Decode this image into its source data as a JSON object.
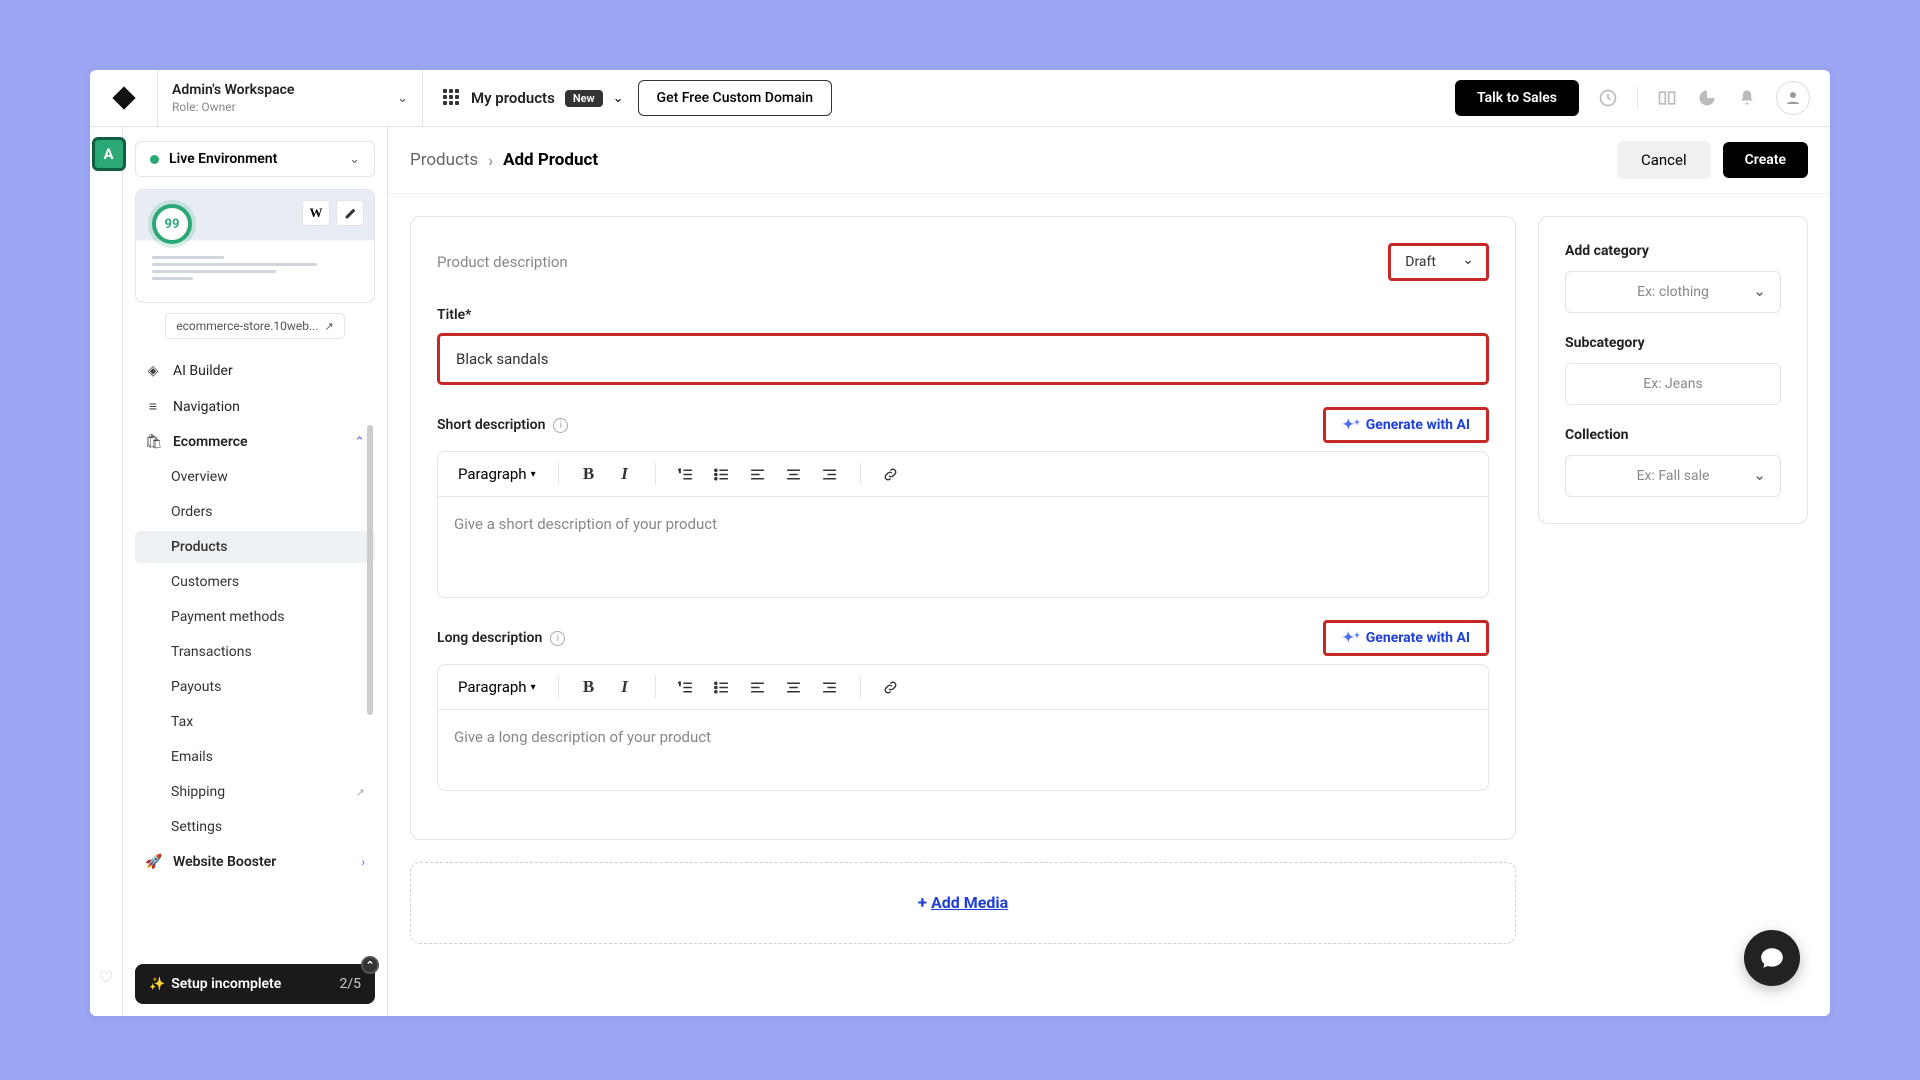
{
  "top": {
    "workspace_name": "Admin's Workspace",
    "workspace_role": "Role: Owner",
    "products_label": "My products",
    "badge": "New",
    "custom_domain": "Get Free Custom Domain",
    "talk_to_sales": "Talk to Sales"
  },
  "sidebar": {
    "rail_avatar": "A",
    "env_label": "Live Environment",
    "score": "99",
    "url": "ecommerce-store.10web...",
    "items": {
      "ai_builder": "AI Builder",
      "navigation": "Navigation",
      "ecommerce": "Ecommerce",
      "website_booster": "Website Booster"
    },
    "sub": {
      "overview": "Overview",
      "orders": "Orders",
      "products": "Products",
      "customers": "Customers",
      "payment": "Payment methods",
      "transactions": "Transactions",
      "payouts": "Payouts",
      "tax": "Tax",
      "emails": "Emails",
      "shipping": "Shipping",
      "settings": "Settings"
    },
    "setup": {
      "label": "Setup incomplete",
      "count": "2/5",
      "chevron": "⌃"
    }
  },
  "crumb": {
    "products": "Products",
    "add": "Add Product",
    "cancel": "Cancel",
    "create": "Create"
  },
  "form": {
    "section": "Product description",
    "draft": "Draft",
    "title_label": "Title*",
    "title_value": "Black sandals",
    "short_label": "Short description",
    "long_label": "Long description",
    "gen": "Generate with AI",
    "paragraph": "Paragraph",
    "short_ph": "Give a short description of your product",
    "long_ph": "Give a long description of your product",
    "add_media": "Add Media"
  },
  "right": {
    "cat_label": "Add category",
    "cat_ph": "Ex: clothing",
    "subcat_label": "Subcategory",
    "subcat_ph": "Ex: Jeans",
    "coll_label": "Collection",
    "coll_ph": "Ex: Fall sale"
  }
}
